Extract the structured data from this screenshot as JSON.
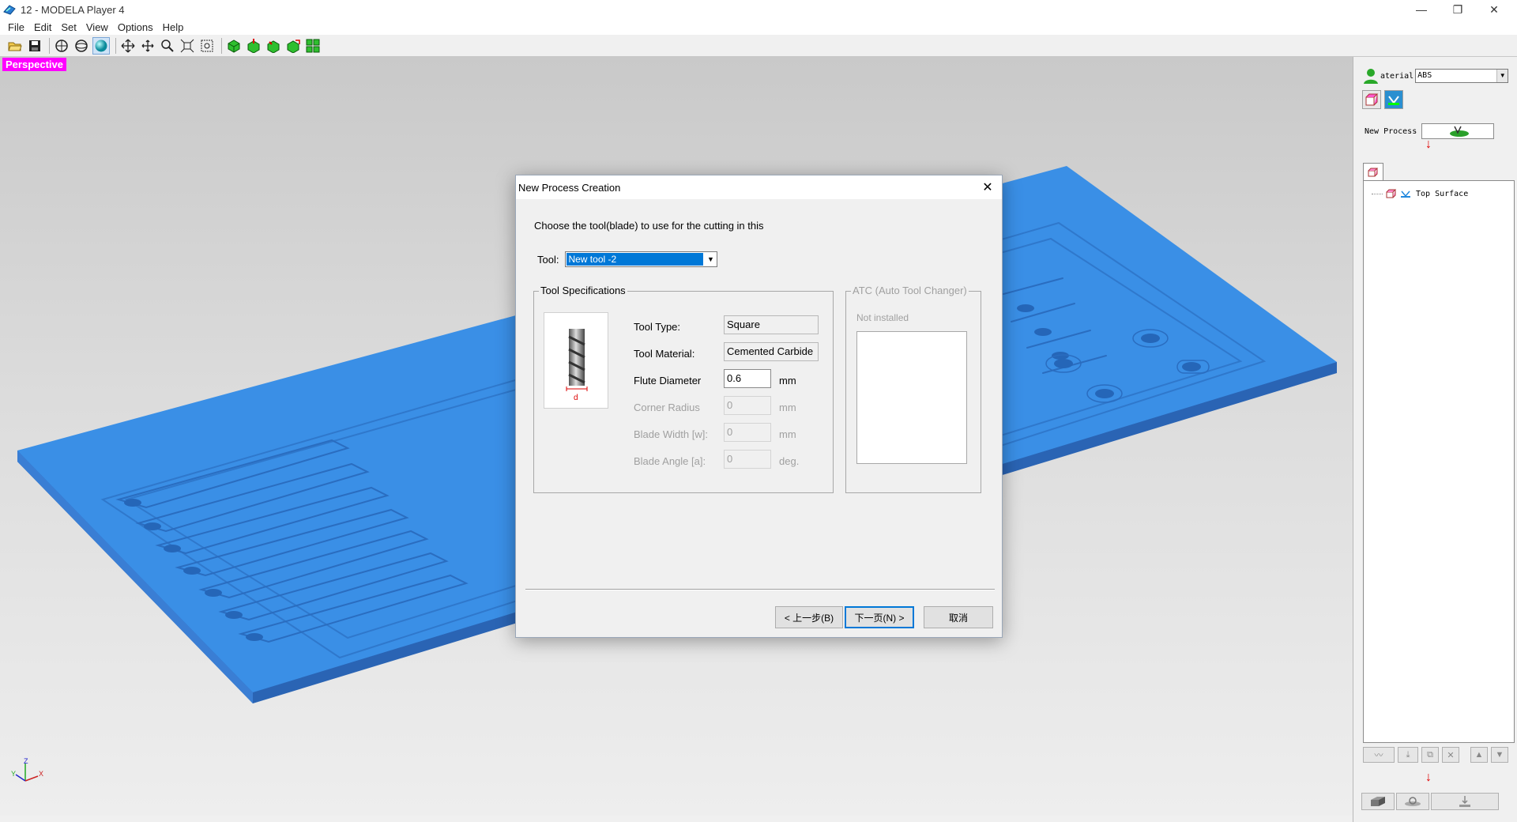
{
  "window": {
    "title": "12 - MODELA Player 4",
    "controls": [
      "—",
      "❐",
      "✕"
    ]
  },
  "menubar": [
    "File",
    "Edit",
    "Set",
    "View",
    "Options",
    "Help"
  ],
  "toolbar": {
    "icons": [
      "open-icon",
      "save-icon",
      "view-3d-icon",
      "view-rotate-icon",
      "shaded-sphere-icon",
      "pan-icon",
      "move-icon",
      "zoom-icon",
      "zoom-fit-icon",
      "zoom-window-icon",
      "cut-all-icon",
      "cut-down-icon",
      "cut-path-icon",
      "cut-preview-icon",
      "layout-icon"
    ],
    "active": "shaded-sphere-icon"
  },
  "viewport": {
    "label": "Perspective",
    "axis": {
      "z": "Z",
      "y": "Y",
      "x": "X"
    },
    "model_color": "#3a8fe6"
  },
  "right_panel": {
    "material_label": "aterial",
    "material_value": "ABS",
    "new_process_label": "New Process",
    "tree_item": "Top Surface"
  },
  "dialog": {
    "title": "New Process Creation",
    "prompt": "Choose the tool(blade) to use for the cutting in this",
    "tool_label": "Tool:",
    "tool_value": "New tool -2",
    "spec_group_title": "Tool Specifications",
    "specs": {
      "tool_type_label": "Tool Type:",
      "tool_type_value": "Square",
      "tool_material_label": "Tool Material:",
      "tool_material_value": "Cemented Carbide",
      "flute_diameter_label": "Flute Diameter",
      "flute_diameter_value": "0.6",
      "flute_diameter_unit": "mm",
      "corner_radius_label": "Corner Radius",
      "corner_radius_value": "0",
      "corner_radius_unit": "mm",
      "blade_width_label": "Blade Width [w]:",
      "blade_width_value": "0",
      "blade_width_unit": "mm",
      "blade_angle_label": "Blade Angle [a]:",
      "blade_angle_value": "0",
      "blade_angle_unit": "deg."
    },
    "tool_diagram_label": "d",
    "atc_group_title": "ATC (Auto Tool Changer)",
    "atc_status": "Not installed",
    "buttons": {
      "back": "< 上一步(B)",
      "next": "下一页(N) >",
      "cancel": "取消"
    }
  }
}
